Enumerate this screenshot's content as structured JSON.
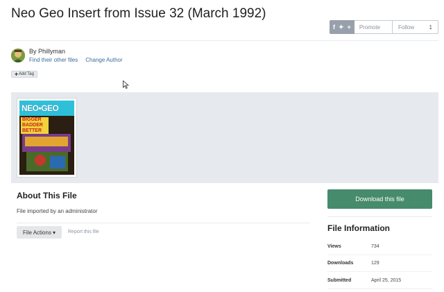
{
  "file": {
    "title": "Neo Geo Insert from Issue 32 (March 1992)"
  },
  "share": {
    "icons": [
      "facebook-icon",
      "twitter-icon",
      "plus-icon"
    ],
    "facebook_glyph": "f",
    "twitter_glyph": "✦",
    "plus_glyph": "+",
    "promote_label": "Promote"
  },
  "follow": {
    "label": "Follow",
    "count": "1"
  },
  "author": {
    "by_label": "By Phillyman",
    "find_other_files": "Find their other files",
    "change_author": "Change Author"
  },
  "tags": {
    "add_tag_label": "Add Tag",
    "add_tag_glyph": "✚"
  },
  "thumbnail": {
    "brand": "NEO•GEO",
    "lines": [
      "BIGGER",
      "BADDER",
      "BETTER"
    ]
  },
  "about": {
    "title": "About This File",
    "description": "File imported by an administrator",
    "file_actions_label": "File Actions",
    "file_actions_caret": "▾",
    "report_label": "Report this file"
  },
  "sidebar": {
    "download_label": "Download this file",
    "info_title": "File Information",
    "rows": [
      {
        "label": "Views",
        "value": "734"
      },
      {
        "label": "Downloads",
        "value": "129"
      },
      {
        "label": "Submitted",
        "value": "April 25, 2015"
      }
    ]
  },
  "colors": {
    "download_button": "#468b6c",
    "link": "#3a6b9c",
    "gallery_bg": "#e6e9ed"
  }
}
